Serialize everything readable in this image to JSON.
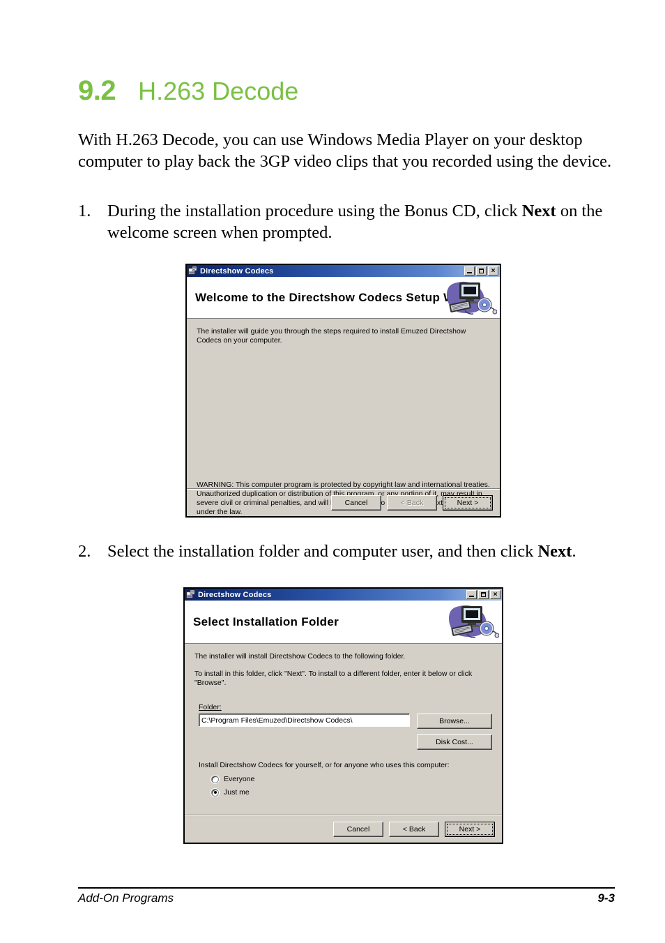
{
  "page": {
    "chapter_number": "9.2",
    "chapter_title": "H.263 Decode",
    "accent_color": "#7AC143",
    "intro_paragraph": "With H.263 Decode, you can use Windows Media Player on your desktop computer to play back the 3GP video clips that you recorded using the device.",
    "steps": [
      {
        "number": "1.",
        "text_before": "During the installation procedure using the Bonus CD, click ",
        "bold": "Next",
        "text_after": " on the welcome screen when prompted."
      },
      {
        "number": "2.",
        "text_before": "Select the installation folder and computer user, and then click ",
        "bold": "Next",
        "text_after": "."
      }
    ],
    "footer": {
      "left": "Add-On Programs",
      "right": "9-3"
    }
  },
  "dialog1": {
    "titlebar": {
      "title": "Directshow Codecs",
      "minimize_label": "",
      "maximize_label": "",
      "close_label": "×"
    },
    "banner_title": "Welcome to the Directshow Codecs Setup Wizard",
    "body_text": "The installer will guide you through the steps required to install Emuzed Directshow Codecs on your computer.",
    "warning_text": "WARNING: This computer program is protected by copyright law and international treaties. Unauthorized duplication or distribution of this program, or any portion of it, may result in severe civil or criminal penalties, and will be prosecuted to the maximum extent possible under the law.",
    "buttons": {
      "cancel": "Cancel",
      "back": "< Back",
      "next": "Next >"
    }
  },
  "dialog2": {
    "titlebar": {
      "title": "Directshow Codecs",
      "close_label": "×"
    },
    "banner_title": "Select Installation Folder",
    "body_text_1": "The installer will install Directshow Codecs to the following folder.",
    "body_text_2": "To install in this folder, click \"Next\". To install to a different folder, enter it below or click \"Browse\".",
    "folder_label": "Folder:",
    "folder_value": "C:\\Program Files\\Emuzed\\Directshow Codecs\\",
    "browse_label": "Browse...",
    "disk_cost_label": "Disk Cost...",
    "user_prompt": "Install Directshow Codecs for yourself, or for anyone who uses this computer:",
    "radio_everyone": "Everyone",
    "radio_justme": "Just me",
    "selected_user_option": "Just me",
    "buttons": {
      "cancel": "Cancel",
      "back": "< Back",
      "next": "Next >"
    }
  }
}
